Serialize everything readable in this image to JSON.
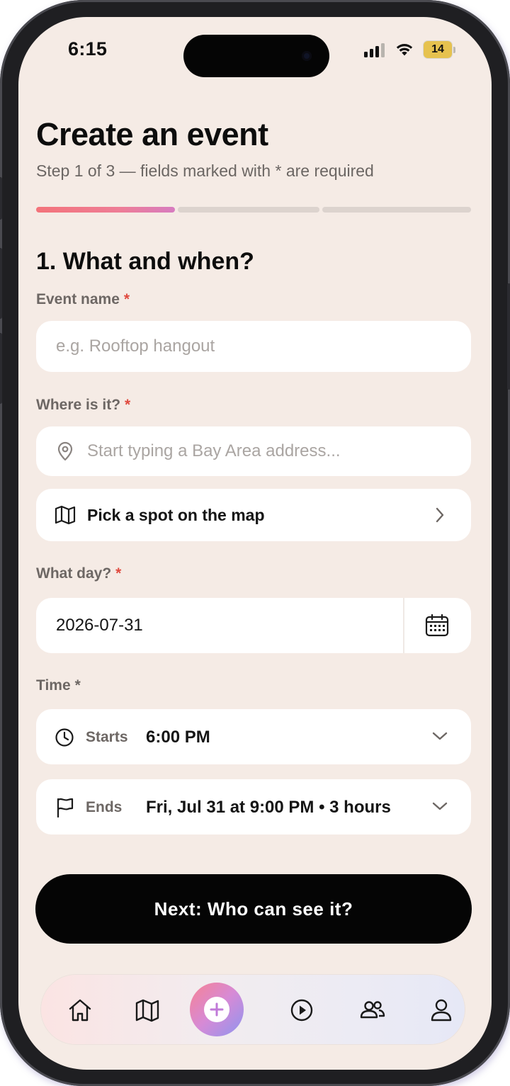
{
  "status_bar": {
    "time": "6:15",
    "battery": "14"
  },
  "header": {
    "title": "Create an event",
    "subtitle": "Step 1 of 3 — fields marked with * are required",
    "progress": {
      "current_step": 1,
      "total_steps": 3
    }
  },
  "section": {
    "title": "1. What and when?"
  },
  "form": {
    "event_name": {
      "label": "Event name",
      "required_mark": "*",
      "placeholder": "e.g. Rooftop hangout"
    },
    "location": {
      "label": "Where is it?",
      "required_mark": "*",
      "placeholder": "Start typing a Bay Area address...",
      "map_button": "Pick a spot on the map"
    },
    "date": {
      "label": "What day?",
      "required_mark": "*",
      "value": "2026-07-31"
    },
    "time": {
      "label": "Time",
      "required_mark": "*",
      "starts_label": "Starts",
      "starts_value": "6:00 PM",
      "ends_label": "Ends",
      "ends_value": "Fri, Jul 31 at 9:00 PM • 3 hours"
    }
  },
  "next_button": "Next: Who can see it?",
  "tabbar": {
    "items": [
      {
        "icon": "home-icon"
      },
      {
        "icon": "map-icon"
      },
      {
        "icon": "create-plus-icon"
      },
      {
        "icon": "play-icon"
      },
      {
        "icon": "people-icon"
      },
      {
        "icon": "profile-icon"
      }
    ]
  },
  "colors": {
    "background": "#f5ebe5",
    "required": "#e04a3f",
    "progress_gradient_start": "#f3737a",
    "progress_gradient_end": "#d77cc0",
    "primary_button": "#050505"
  }
}
